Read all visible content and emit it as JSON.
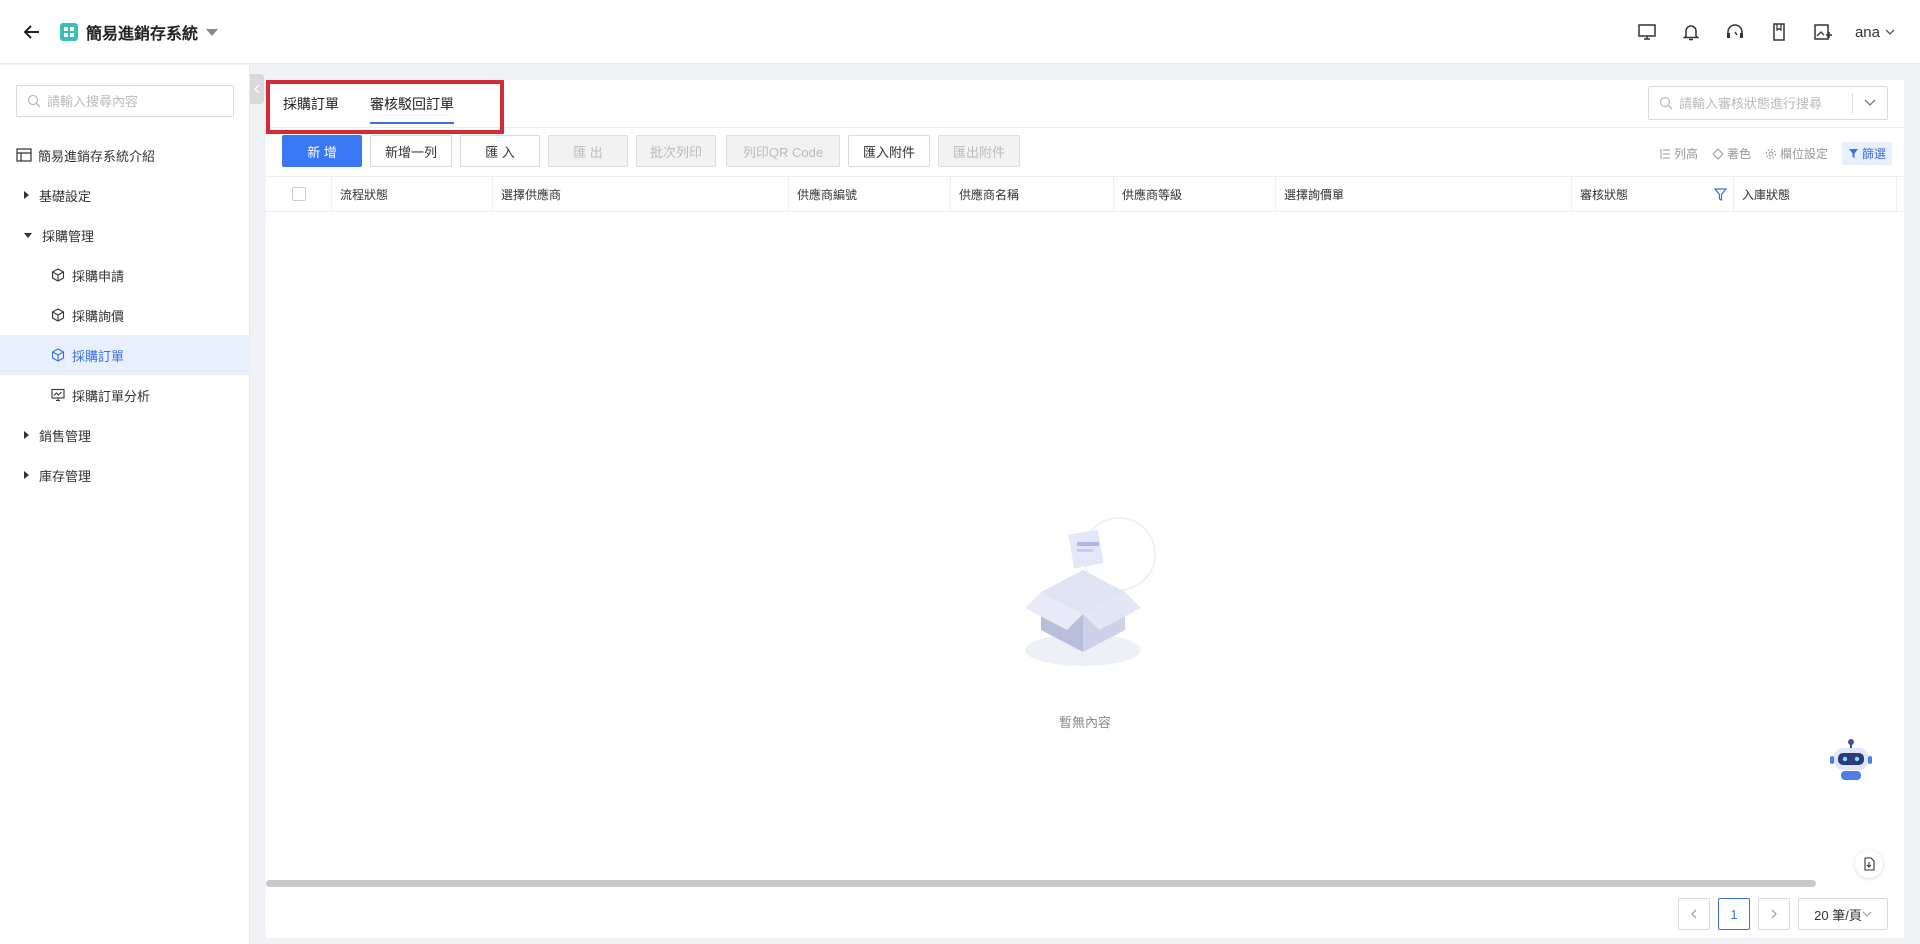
{
  "header": {
    "app_title": "簡易進銷存系統",
    "user_name": "ana"
  },
  "sidebar": {
    "search_placeholder": "請輸入搜尋內容",
    "items": [
      {
        "label": "簡易進銷存系統介紹"
      },
      {
        "label": "基礎設定"
      },
      {
        "label": "採購管理"
      },
      {
        "label": "採購申請"
      },
      {
        "label": "採購詢價"
      },
      {
        "label": "採購訂單"
      },
      {
        "label": "採購訂單分析"
      },
      {
        "label": "銷售管理"
      },
      {
        "label": "庫存管理"
      }
    ]
  },
  "tabs": [
    {
      "label": "採購訂單"
    },
    {
      "label": "審核駁回訂單"
    }
  ],
  "filter": {
    "placeholder": "請輸入審核狀態進行搜尋"
  },
  "toolbar": {
    "buttons": [
      {
        "label": "新 增"
      },
      {
        "label": "新增一列"
      },
      {
        "label": "匯 入"
      },
      {
        "label": "匯 出"
      },
      {
        "label": "批次列印"
      },
      {
        "label": "列印QR Code"
      },
      {
        "label": "匯入附件"
      },
      {
        "label": "匯出附件"
      }
    ],
    "right": {
      "row_height": "列高",
      "coloring": "著色",
      "column_settings": "欄位設定",
      "filter": "篩選"
    }
  },
  "table": {
    "columns": [
      "流程狀態",
      "選擇供應商",
      "供應商編號",
      "供應商名稱",
      "供應商等級",
      "選擇詢價單",
      "審核狀態",
      "入庫狀態"
    ]
  },
  "empty_text": "暫無內容",
  "pagination": {
    "current_page": "1",
    "page_size": "20 筆/頁"
  },
  "colors": {
    "accent": "#3b6fe8",
    "primary_button": "#3b78f5",
    "highlight": "#d62b36",
    "logo": "#3cc0b5"
  }
}
